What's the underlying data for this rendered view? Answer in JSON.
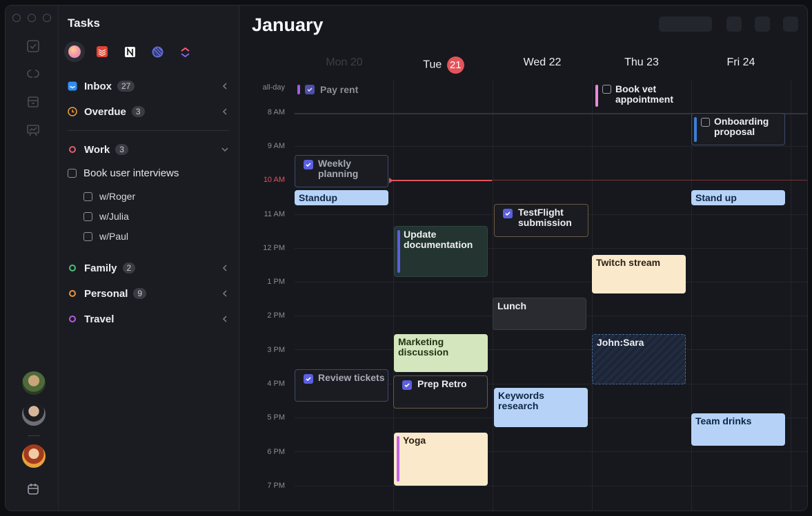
{
  "rail": {
    "icons": [
      "checkbox-icon",
      "at-link-icon",
      "archive-icon",
      "chart-board-icon",
      "calendar-icon"
    ],
    "avatars": [
      "avatar-1",
      "avatar-2",
      "avatar-3"
    ]
  },
  "sidebar": {
    "title": "Tasks",
    "integrations": [
      "gradient-orb",
      "todoist",
      "notion",
      "linear",
      "clickup"
    ],
    "inbox": {
      "label": "Inbox",
      "count": "27"
    },
    "overdue": {
      "label": "Overdue",
      "count": "3"
    },
    "work": {
      "label": "Work",
      "count": "3"
    },
    "tasks": [
      {
        "label": "Book user interviews"
      },
      {
        "label": "w/Roger"
      },
      {
        "label": "w/Julia"
      },
      {
        "label": "w/Paul"
      }
    ],
    "family": {
      "label": "Family",
      "count": "2"
    },
    "personal": {
      "label": "Personal",
      "count": "9"
    },
    "travel": {
      "label": "Travel"
    },
    "colors": {
      "work": "#e25d6b",
      "family": "#4fbf7a",
      "personal": "#f2913b",
      "travel": "#b55be0"
    }
  },
  "calendar": {
    "month": "January",
    "days": [
      {
        "label": "Mon 20"
      },
      {
        "label": "Tue",
        "num": "21"
      },
      {
        "label": "Wed 22"
      },
      {
        "label": "Thu 23"
      },
      {
        "label": "Fri 24"
      }
    ],
    "allday_label": "all-day",
    "times": [
      "8 AM",
      "9 AM",
      "10 AM",
      "11 AM",
      "12 PM",
      "1 PM",
      "2 PM",
      "3 PM",
      "4 PM",
      "5 PM",
      "6 PM",
      "7 PM"
    ],
    "events": {
      "pay_rent": "Pay rent",
      "book_vet": "Book vet appointment",
      "onboarding": "Onboarding proposal",
      "weekly_planning": "Weekly planning",
      "standup_mon": "Standup",
      "standup_fri": "Stand up",
      "testflight": "TestFlight submission",
      "update_docs": "Update documentation",
      "twitch": "Twitch stream",
      "lunch": "Lunch",
      "marketing": "Marketing discussion",
      "john_sara": "John:Sara",
      "review_tickets": "Review tickets",
      "prep_retro": "Prep Retro",
      "keywords": "Keywords research",
      "team_drinks": "Team drinks",
      "yoga": "Yoga"
    },
    "accent": "#e2545b"
  }
}
